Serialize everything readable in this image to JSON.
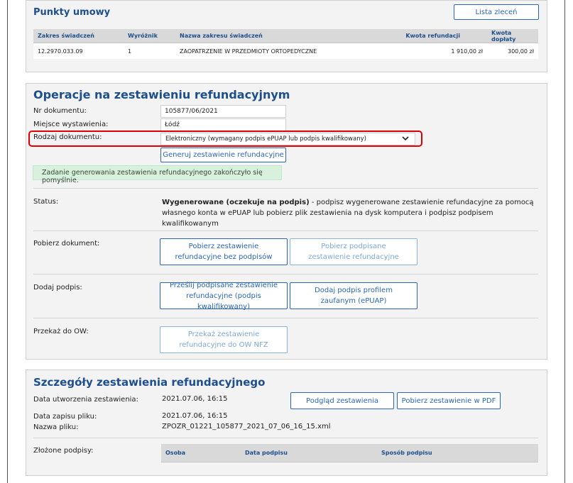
{
  "punkty": {
    "title": "Punkty umowy",
    "lista_btn": "Lista zleceń",
    "headers": [
      "Zakres świadczeń",
      "Wyróżnik",
      "Nazwa zakresu świadczeń",
      "Kwota refundacji",
      "Kwota dopłaty"
    ],
    "row": [
      "12.2970.033.09",
      "1",
      "ZAOPATRZENIE W PRZEDMIOTY ORTOPEDYCZNE",
      "1 910,00 zł",
      "300,00 zł"
    ]
  },
  "operacje": {
    "title": "Operacje na zestawieniu refundacyjnym",
    "nr_label": "Nr dokumentu:",
    "nr_value": "105877/06/2021",
    "miejsce_label": "Miejsce wystawienia:",
    "miejsce_value": "Łódź",
    "rodzaj_label": "Rodzaj dokumentu:",
    "rodzaj_value": "Elektroniczny (wymagany podpis ePUAP lub podpis kwalifikowany)",
    "generuj_btn": "Generuj zestawienie refundacyjne",
    "success_msg": "Zadanie generowania zestawienia refundacyjnego zakończyło się pomyślnie.",
    "status_label": "Status:",
    "status_bold": "Wygenerowane (oczekuje na podpis)",
    "status_text": " - podpisz wygenerowane zestawienie refundacyjne za pomocą własnego konta w ePUAP lub pobierz plik zestawienia na dysk komputera i podpisz podpisem kwalifikowanym",
    "pobierz_label": "Pobierz dokument:",
    "pobierz_bez_btn": "Pobierz zestawienie refundacyjne bez podpisów",
    "pobierz_podp_btn": "Pobierz podpisane zestawienie refundacyjne",
    "dodaj_label": "Dodaj podpis:",
    "przeslij_btn": "Prześlij podpisane zestawienie refundacyjne (podpis kwalifikowany)",
    "dodaj_profil_btn": "Dodaj podpis profilem zaufanym (ePUAP)",
    "przekaz_label": "Przekaż do OW:",
    "przekaz_btn": "Przekaż zestawienie refundacyjne do OW NFZ"
  },
  "szczegoly": {
    "title": "Szczegóły zestawienia refundacyjnego",
    "data_utw_label": "Data utworzenia zestawienia:",
    "data_utw_value": "2021.07.06, 16:15",
    "podglad_btn": "Podgląd zestawienia",
    "pdf_btn": "Pobierz zestawienie w PDF",
    "data_zapisu_label": "Data zapisu pliku:",
    "data_zapisu_value": "2021.07.06, 16:15",
    "nazwa_label": "Nazwa pliku:",
    "nazwa_value": "ZPOZR_01221_105877_2021_07_06_16_15.xml",
    "zlozone_label": "Złożone podpisy:",
    "headers": [
      "Osoba",
      "Data podpisu",
      "Sposób podpisu"
    ]
  },
  "colors": {
    "accent": "#1d4f8f",
    "button": "#2a66b8",
    "highlight": "#e00000",
    "success_bg": "#d8f1dc"
  }
}
